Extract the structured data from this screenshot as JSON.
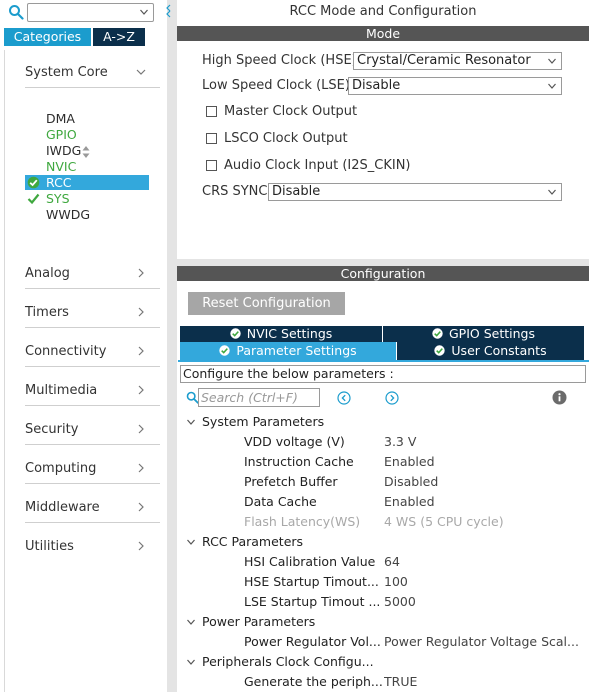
{
  "left": {
    "search": {
      "value": ""
    },
    "tabs": [
      {
        "label": "Categories"
      },
      {
        "label": "A->Z"
      }
    ],
    "system_core": {
      "label": "System Core",
      "items": [
        {
          "label": "DMA",
          "state": "normal"
        },
        {
          "label": "GPIO",
          "state": "green"
        },
        {
          "label": "IWDG",
          "state": "normal"
        },
        {
          "label": "NVIC",
          "state": "green"
        },
        {
          "label": "RCC",
          "state": "selected-warning"
        },
        {
          "label": "SYS",
          "state": "green-check"
        },
        {
          "label": "WWDG",
          "state": "normal"
        }
      ]
    },
    "categories": [
      {
        "label": "Analog"
      },
      {
        "label": "Timers"
      },
      {
        "label": "Connectivity"
      },
      {
        "label": "Multimedia"
      },
      {
        "label": "Security"
      },
      {
        "label": "Computing"
      },
      {
        "label": "Middleware"
      },
      {
        "label": "Utilities"
      }
    ]
  },
  "right": {
    "title": "RCC Mode and Configuration",
    "mode_bar": "Mode",
    "mode": {
      "hse": {
        "label": "High Speed Clock (HSE)",
        "value": "Crystal/Ceramic Resonator"
      },
      "lse": {
        "label": "Low Speed Clock (LSE)",
        "value": "Disable"
      },
      "checkboxes": [
        {
          "label": "Master Clock Output",
          "checked": false
        },
        {
          "label": "LSCO Clock Output",
          "checked": false
        },
        {
          "label": "Audio Clock Input (I2S_CKIN)",
          "checked": false
        }
      ],
      "crs": {
        "label": "CRS SYNC",
        "value": "Disable"
      }
    },
    "config_bar": "Configuration",
    "reset_label": "Reset Configuration",
    "settings_tabs": [
      {
        "label": "NVIC Settings",
        "active": false
      },
      {
        "label": "GPIO Settings",
        "active": false
      },
      {
        "label": "Parameter Settings",
        "active": true
      },
      {
        "label": "User Constants",
        "active": false
      }
    ],
    "params": {
      "hint": "Configure the below parameters :",
      "search_placeholder": "Search (Ctrl+F)",
      "groups": [
        {
          "label": "System Parameters",
          "rows": [
            {
              "name": "VDD voltage (V)",
              "value": "3.3 V",
              "dim": false
            },
            {
              "name": "Instruction Cache",
              "value": "Enabled",
              "dim": false
            },
            {
              "name": "Prefetch Buffer",
              "value": "Disabled",
              "dim": false
            },
            {
              "name": "Data Cache",
              "value": "Enabled",
              "dim": false
            },
            {
              "name": "Flash Latency(WS)",
              "value": "4 WS (5 CPU cycle)",
              "dim": true
            }
          ]
        },
        {
          "label": "RCC Parameters",
          "rows": [
            {
              "name": "HSI Calibration Value",
              "value": "64",
              "dim": false
            },
            {
              "name": "HSE Startup Timout...",
              "value": "100",
              "dim": false
            },
            {
              "name": "LSE Startup Timout ...",
              "value": "5000",
              "dim": false
            }
          ]
        },
        {
          "label": "Power Parameters",
          "rows": [
            {
              "name": "Power Regulator Vol...",
              "value": "Power Regulator Voltage Scal...",
              "dim": false
            }
          ]
        },
        {
          "label": "Peripherals Clock Configu...",
          "rows": [
            {
              "name": "Generate the periph...",
              "value": "TRUE",
              "dim": false
            }
          ]
        }
      ]
    }
  }
}
